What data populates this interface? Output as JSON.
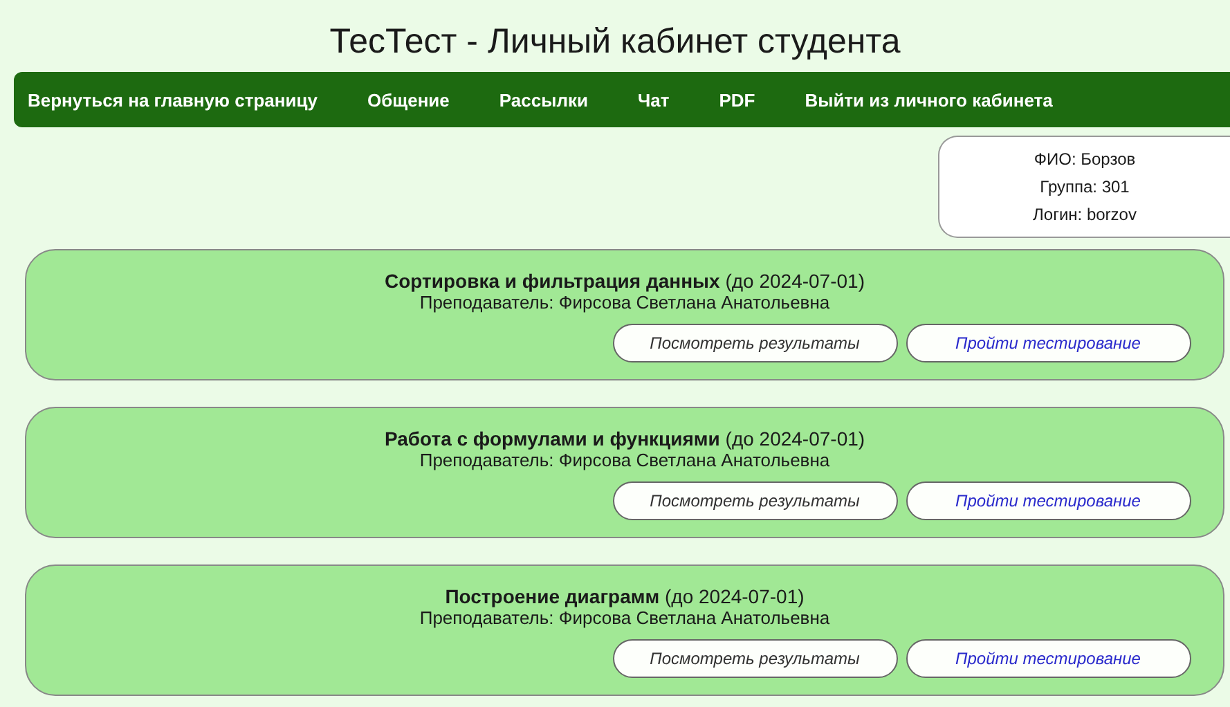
{
  "page_title": "ТесТест - Личный кабинет студента",
  "nav": [
    "Вернуться на главную страницу",
    "Общение",
    "Рассылки",
    "Чат",
    "PDF",
    "Выйти из личного кабинета"
  ],
  "profile": [
    "ФИО: Борзов",
    "Группа: 301",
    "Логин: borzov"
  ],
  "courses": [
    {
      "heading": "**Сортировка и фильтрация данных** (до 2024-07-01)",
      "teacher": "Преподаватель: Фирсова Светлана Анатольевна",
      "results_button": "Посмотреть результаты",
      "test_button": "Пройти тестирование"
    },
    {
      "heading": "**Работа с формулами и функциями** (до 2024-07-01)",
      "teacher": "Преподаватель: Фирсова Светлана Анатольевна",
      "results_button": "Посмотреть результаты",
      "test_button": "Пройти тестирование"
    },
    {
      "heading": "**Построение диаграмм** (до 2024-07-01)",
      "teacher": "Преподаватель: Фирсова Светлана Анатольевна",
      "results_button": "Посмотреть результаты",
      "test_button": "Пройти тестирование"
    }
  ]
}
